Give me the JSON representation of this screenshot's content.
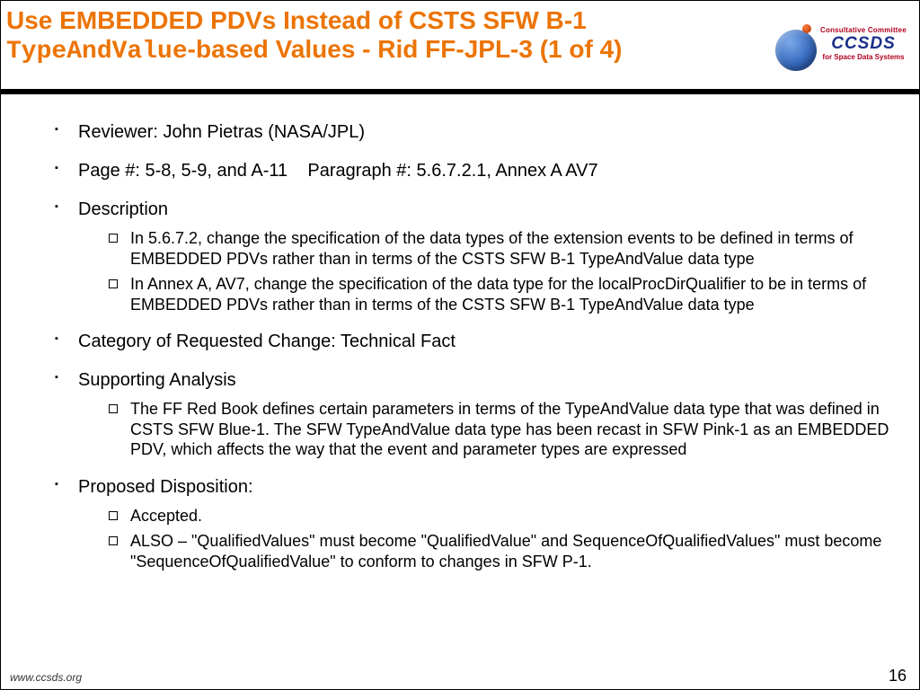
{
  "title": {
    "line1": "Use EMBEDDED PDVs Instead of CSTS SFW B-1 ",
    "mono": "TypeAndValue",
    "line2_rest": "-based Values - Rid FF-JPL-3 (1 of 4)"
  },
  "logo": {
    "line1": "Consultative Committee",
    "acronym": "CCSDS",
    "line2": "for Space Data Systems"
  },
  "bullets": {
    "reviewer": "Reviewer: John Pietras (NASA/JPL)",
    "page": "Page #: 5-8, 5-9, and A-11    Paragraph #: 5.6.7.2.1, Annex A AV7",
    "desc_label": "Description",
    "desc_items": [
      "In 5.6.7.2, change the specification of the data types of the extension events to be defined in terms of EMBEDDED PDVs rather than in terms of the CSTS SFW B-1 TypeAndValue data type",
      "In Annex A, AV7, change the specification of the data type for the localProcDirQualifier to be in terms of EMBEDDED PDVs rather than in terms of the CSTS SFW B-1 TypeAndValue data type"
    ],
    "category": "Category of Requested Change: Technical Fact",
    "support_label": "Supporting Analysis",
    "support_items": [
      "The FF Red Book defines certain parameters in terms of the TypeAndValue data type that was defined in CSTS SFW Blue-1. The SFW TypeAndValue data type has been recast in SFW Pink-1 as an EMBEDDED PDV, which affects the way that the event and parameter types are expressed"
    ],
    "disp_label": "Proposed Disposition:",
    "disp_items": [
      "Accepted.",
      "ALSO – \"QualifiedValues\" must become \"QualifiedValue\" and SequenceOfQualifiedValues\" must become \"SequenceOfQualifiedValue\" to conform to changes in SFW P-1."
    ]
  },
  "footer": {
    "url": "www.ccsds.org",
    "page": "16"
  }
}
